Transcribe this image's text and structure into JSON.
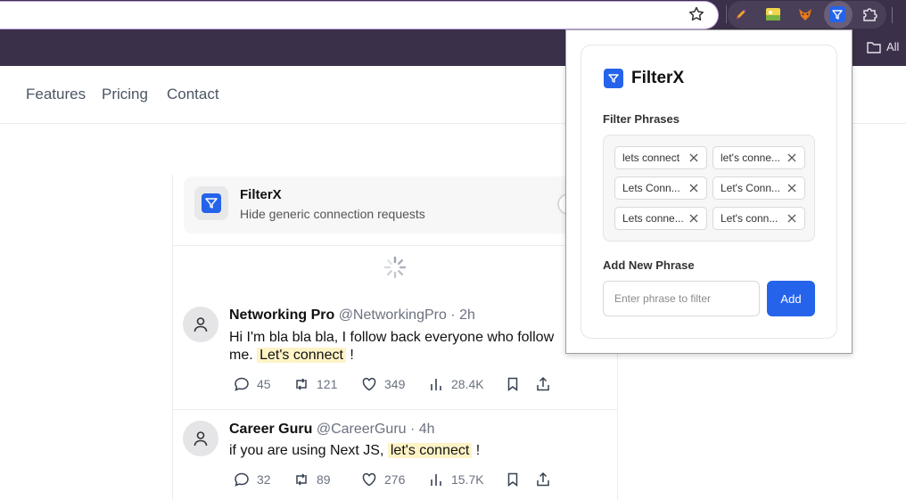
{
  "browser": {
    "bookmarks_folder_label": "All",
    "extensions": [
      "pencil-icon",
      "image-extension-icon",
      "fox-icon",
      "filterx-icon",
      "puzzle-icon"
    ]
  },
  "site": {
    "nav": [
      "Features",
      "Pricing",
      "Contact"
    ]
  },
  "banner": {
    "title": "FilterX",
    "subtitle": "Hide generic connection requests"
  },
  "tweets": [
    {
      "name": "Networking Pro",
      "meta": "@NetworkingPro · 2h",
      "line1": "Hi I'm bla bla bla, I follow back everyone who follow",
      "line2_prefix": "me.",
      "highlight": "Let's connect",
      "suffix": "!",
      "replies": "45",
      "retweets": "121",
      "likes": "349",
      "views": "28.4K"
    },
    {
      "name": "Career Guru",
      "meta": "@CareerGuru · 4h",
      "line1_prefix": "if you are using Next JS,",
      "highlight": "let's connect",
      "suffix": "!",
      "replies": "32",
      "retweets": "89",
      "likes": "276",
      "views": "15.7K"
    }
  ],
  "popup": {
    "title": "FilterX",
    "filter_label": "Filter Phrases",
    "chips": [
      "lets connect",
      "let's conne...",
      "Lets Conn...",
      "Let's Conn...",
      "Lets conne...",
      "Let's conn..."
    ],
    "add_label": "Add New Phrase",
    "input_value": "",
    "input_placeholder": "Enter phrase to filter",
    "add_button": "Add"
  },
  "colors": {
    "browser_chrome": "#3b3049",
    "accent_blue": "#2563eb",
    "highlight": "#fef3c7"
  }
}
